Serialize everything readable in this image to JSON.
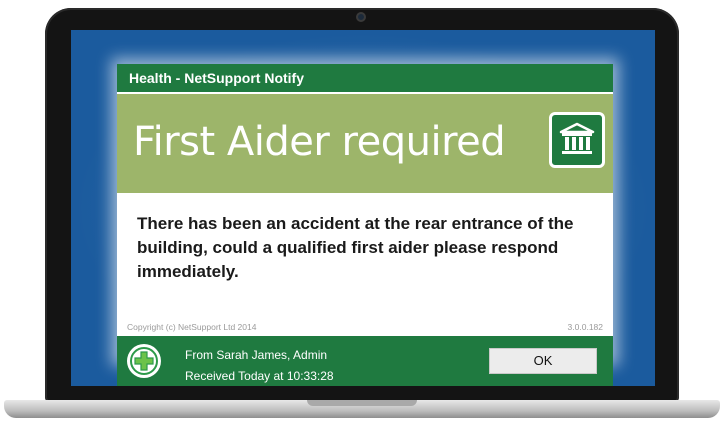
{
  "dialog": {
    "title": "Health - NetSupport Notify",
    "heading": "First Aider required",
    "message": "There has been an accident at the rear entrance of the building, could a qualified first aider please respond immediately.",
    "copyright": "Copyright (c) NetSupport Ltd 2014",
    "version": "3.0.0.182",
    "category_icon": "building-icon",
    "footer": {
      "icon": "first-aid-cross-icon",
      "from": "From Sarah James, Admin",
      "received": "Received Today at 10:33:28",
      "ok_label": "OK"
    }
  },
  "colors": {
    "title_bar": "#1f7a40",
    "heading_band": "#9db56a",
    "screen_background": "#1b5b9e",
    "footer": "#1f7a40"
  }
}
